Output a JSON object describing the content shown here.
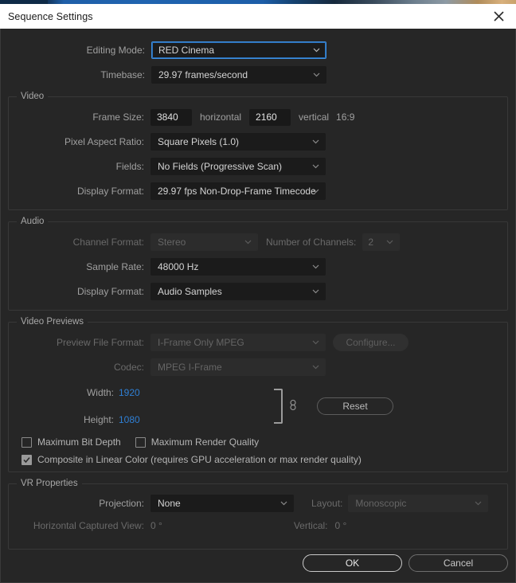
{
  "window": {
    "title": "Sequence Settings",
    "close_icon": "close-icon"
  },
  "top_fields": {
    "editing_mode_label": "Editing Mode:",
    "editing_mode_value": "RED Cinema",
    "timebase_label": "Timebase:",
    "timebase_value": "29.97  frames/second"
  },
  "video": {
    "legend": "Video",
    "frame_size_label": "Frame Size:",
    "frame_width": "3840",
    "horizontal_label": "horizontal",
    "frame_height": "2160",
    "vertical_label": "vertical",
    "aspect_ratio": "16:9",
    "pixel_aspect_label": "Pixel Aspect Ratio:",
    "pixel_aspect_value": "Square Pixels (1.0)",
    "fields_label": "Fields:",
    "fields_value": "No Fields (Progressive Scan)",
    "display_format_label": "Display Format:",
    "display_format_value": "29.97 fps Non-Drop-Frame Timecode"
  },
  "audio": {
    "legend": "Audio",
    "channel_format_label": "Channel Format:",
    "channel_format_value": "Stereo",
    "number_of_channels_label": "Number of Channels:",
    "number_of_channels_value": "2",
    "sample_rate_label": "Sample Rate:",
    "sample_rate_value": "48000 Hz",
    "display_format_label": "Display Format:",
    "display_format_value": "Audio Samples"
  },
  "video_previews": {
    "legend": "Video Previews",
    "preview_file_format_label": "Preview File Format:",
    "preview_file_format_value": "I-Frame Only MPEG",
    "configure_label": "Configure...",
    "codec_label": "Codec:",
    "codec_value": "MPEG I-Frame",
    "width_label": "Width:",
    "width_value": "1920",
    "height_label": "Height:",
    "height_value": "1080",
    "reset_label": "Reset",
    "max_bit_depth_label": "Maximum Bit Depth",
    "max_bit_depth_checked": false,
    "max_render_quality_label": "Maximum Render Quality",
    "max_render_quality_checked": false,
    "composite_linear_label": "Composite in Linear Color (requires GPU acceleration or max render quality)",
    "composite_linear_checked": true
  },
  "vr": {
    "legend": "VR Properties",
    "projection_label": "Projection:",
    "projection_value": "None",
    "layout_label": "Layout:",
    "layout_value": "Monoscopic",
    "horizontal_captured_view_label": "Horizontal Captured View:",
    "horizontal_captured_view_value": "0 °",
    "vertical_label": "Vertical:",
    "vertical_value": "0 °"
  },
  "footer": {
    "ok_label": "OK",
    "cancel_label": "Cancel"
  },
  "colors": {
    "accent_focus": "#3d8ee0",
    "link_value": "#2f7fd4",
    "panel_bg": "#262626",
    "titlebar_bg": "#ffffff"
  }
}
